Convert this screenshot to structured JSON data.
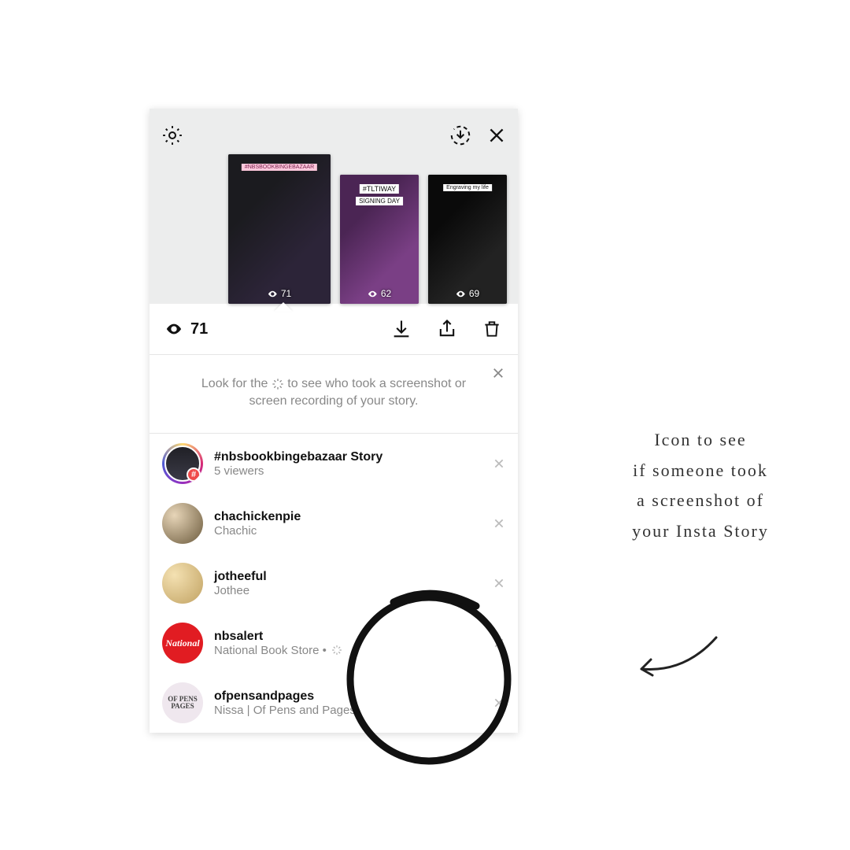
{
  "icons": {
    "eye": "eye",
    "burst": "burst"
  },
  "thumbs": [
    {
      "views": "71",
      "tag": "#NBSBOOKBINGEBAZAAR",
      "tag_class": "pink"
    },
    {
      "views": "62",
      "tag": "#TLTIWAY",
      "subtag": "SIGNING DAY"
    },
    {
      "views": "69",
      "tag": "Engraving my life"
    }
  ],
  "view_count": "71",
  "hint_text_before": "Look for the ",
  "hint_text_after": " to see who took a screenshot or screen recording of your story.",
  "viewers": [
    {
      "name": "#nbsbookbingebazaar Story",
      "sub": "5 viewers",
      "avatar": "ring"
    },
    {
      "name": "chachickenpie",
      "sub": "Chachic",
      "avatar": "c2"
    },
    {
      "name": "jotheeful",
      "sub": "Jothee",
      "avatar": "c3"
    },
    {
      "name": "nbsalert",
      "sub": "National Book Store • ",
      "avatar": "c4",
      "burst": true,
      "avatar_text": "National"
    },
    {
      "name": "ofpensandpages",
      "sub": "Nissa | Of Pens and Pages",
      "avatar": "c5",
      "avatar_text": "OF PENS\nPAGES"
    }
  ],
  "caption_lines": [
    "Icon to see",
    "if someone took",
    "a screenshot of",
    "your Insta Story"
  ]
}
